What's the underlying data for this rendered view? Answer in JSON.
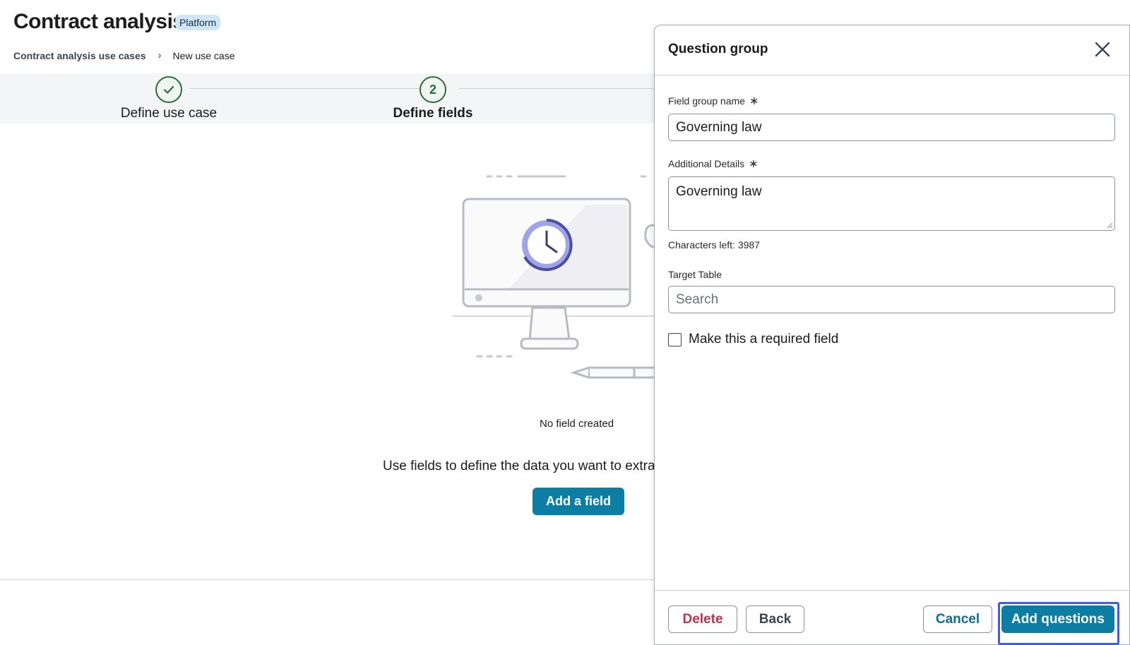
{
  "header": {
    "title": "Contract analysis",
    "badge": "Platform"
  },
  "breadcrumb": {
    "parent": "Contract analysis use cases",
    "separator": "›",
    "current": "New use case"
  },
  "stepper": {
    "steps": [
      {
        "label": "Define use case",
        "state": "complete",
        "marker": "✓"
      },
      {
        "label": "Define fields",
        "state": "active",
        "marker": "2"
      }
    ],
    "complete_color": "#2f6b3a"
  },
  "empty_state": {
    "title": "No field created",
    "description": "Use fields to define the data you want to extra",
    "add_button": "Add a field"
  },
  "panel": {
    "title": "Question group",
    "close_icon": "close-icon",
    "field_group_name": {
      "label": "Field group name",
      "required_marker": "∗",
      "value": "Governing law"
    },
    "additional_details": {
      "label": "Additional Details",
      "required_marker": "∗",
      "value": "Governing law"
    },
    "chars_left": "Characters left: 3987",
    "target_table": {
      "label": "Target Table",
      "placeholder": "Search"
    },
    "required_checkbox": {
      "label": "Make this a required field",
      "checked": false
    },
    "footer": {
      "delete": "Delete",
      "back": "Back",
      "cancel": "Cancel",
      "add_questions": "Add questions"
    }
  },
  "colors": {
    "primary": "#0d7ea3",
    "danger": "#c0314a",
    "focus": "#3d5bf0"
  }
}
